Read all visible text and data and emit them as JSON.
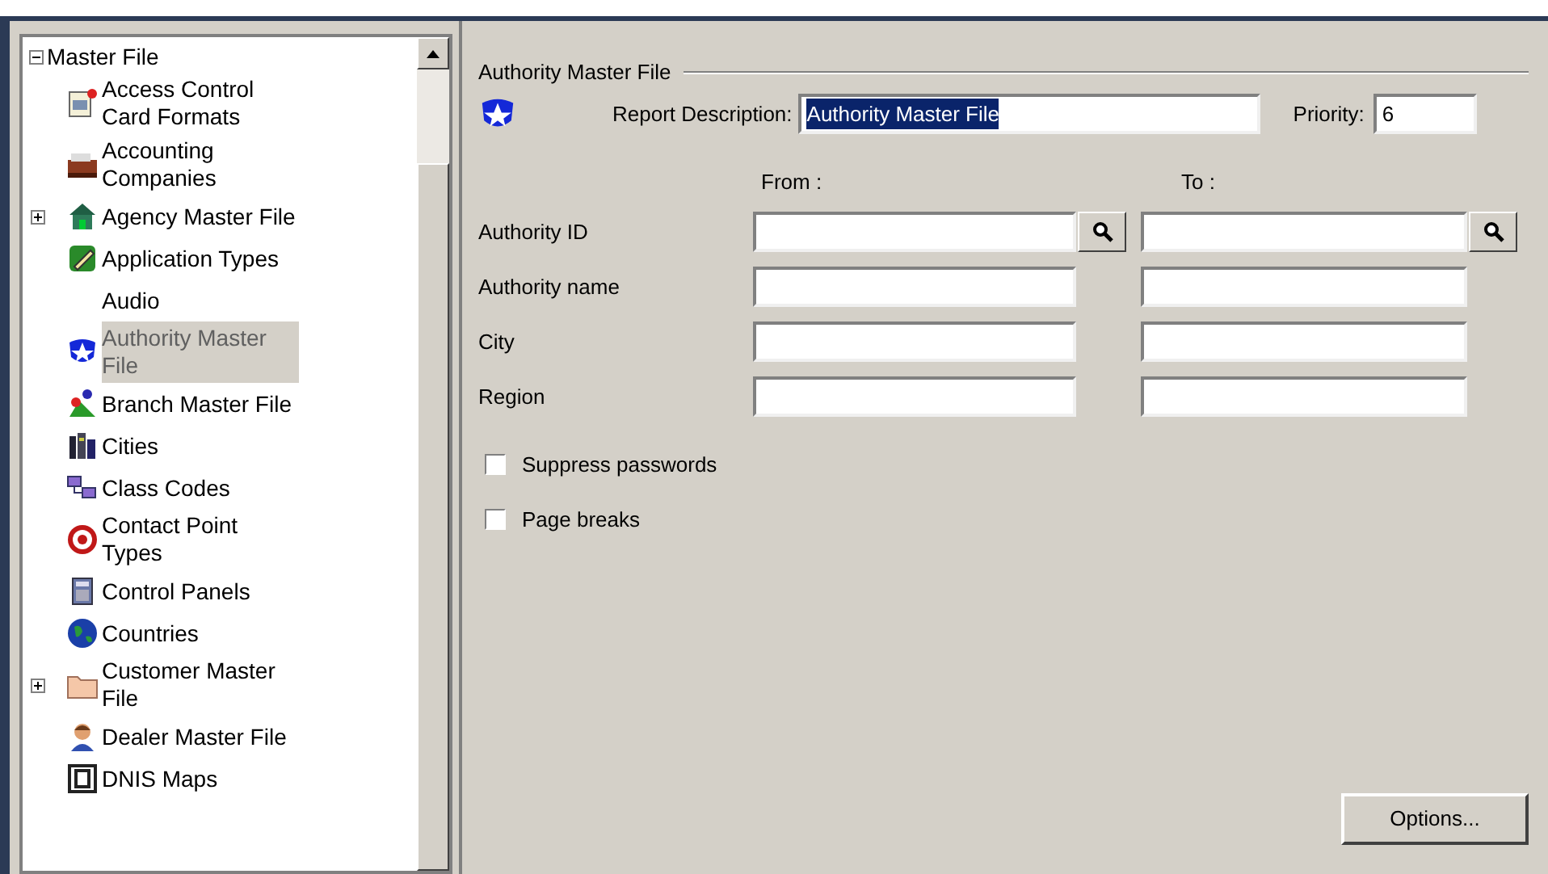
{
  "tree": {
    "label": "Master File",
    "expanded": true,
    "children": [
      {
        "label": "Access Control Card Formats",
        "selected": false
      },
      {
        "label": "Accounting Companies",
        "selected": false
      },
      {
        "label": "Agency Master File",
        "selected": false,
        "expanded": false
      },
      {
        "label": "Application Types",
        "selected": false
      },
      {
        "label": "Audio",
        "selected": false
      },
      {
        "label": "Authority Master File",
        "selected": true
      },
      {
        "label": "Branch Master File",
        "selected": false
      },
      {
        "label": "Cities",
        "selected": false
      },
      {
        "label": "Class Codes",
        "selected": false
      },
      {
        "label": "Contact Point Types",
        "selected": false
      },
      {
        "label": "Control Panels",
        "selected": false
      },
      {
        "label": "Countries",
        "selected": false
      },
      {
        "label": "Customer Master File",
        "selected": false,
        "expanded": false
      },
      {
        "label": "Dealer Master File",
        "selected": false
      },
      {
        "label": "DNIS Maps",
        "selected": false
      }
    ]
  },
  "form": {
    "group_title": "Authority Master File",
    "report_description": {
      "label": "Report Description:",
      "value": "Authority Master File",
      "highlighted": true
    },
    "priority": {
      "label": "Priority:",
      "value": "6"
    },
    "from_header": "From :",
    "to_header": "To :",
    "rows": [
      {
        "label": "Authority ID",
        "kind": "lookup"
      },
      {
        "label": "Authority name",
        "kind": "text"
      },
      {
        "label": "City",
        "kind": "text"
      },
      {
        "label": "Region",
        "kind": "text"
      }
    ],
    "checkboxes": [
      {
        "label": "Suppress passwords",
        "checked": false
      },
      {
        "label": "Page breaks",
        "checked": false
      }
    ],
    "options_button": "Options..."
  }
}
